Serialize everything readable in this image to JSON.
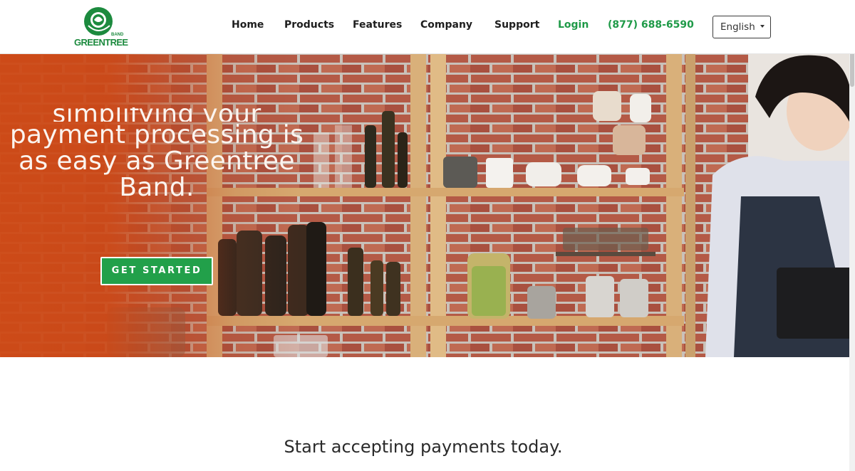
{
  "brand": {
    "logo_text": "GREENTREE",
    "logo_small": "BAND"
  },
  "nav": {
    "home": "Home",
    "products": "Products",
    "features": "Features",
    "company": "Company",
    "support": "Support",
    "login": "Login",
    "phone": "(877) 688-6590",
    "language": "English"
  },
  "hero": {
    "headline_line0": "simplifying your",
    "headline_line1": "payment processing is",
    "headline_line2": "as easy as Greentree",
    "headline_line3": "Band.",
    "cta": "GET STARTED"
  },
  "section": {
    "subheading": "Start accepting payments today."
  },
  "colors": {
    "brand_green": "#1f9a48",
    "button_green": "#22a04a",
    "hero_orange": "#ce4a16"
  }
}
